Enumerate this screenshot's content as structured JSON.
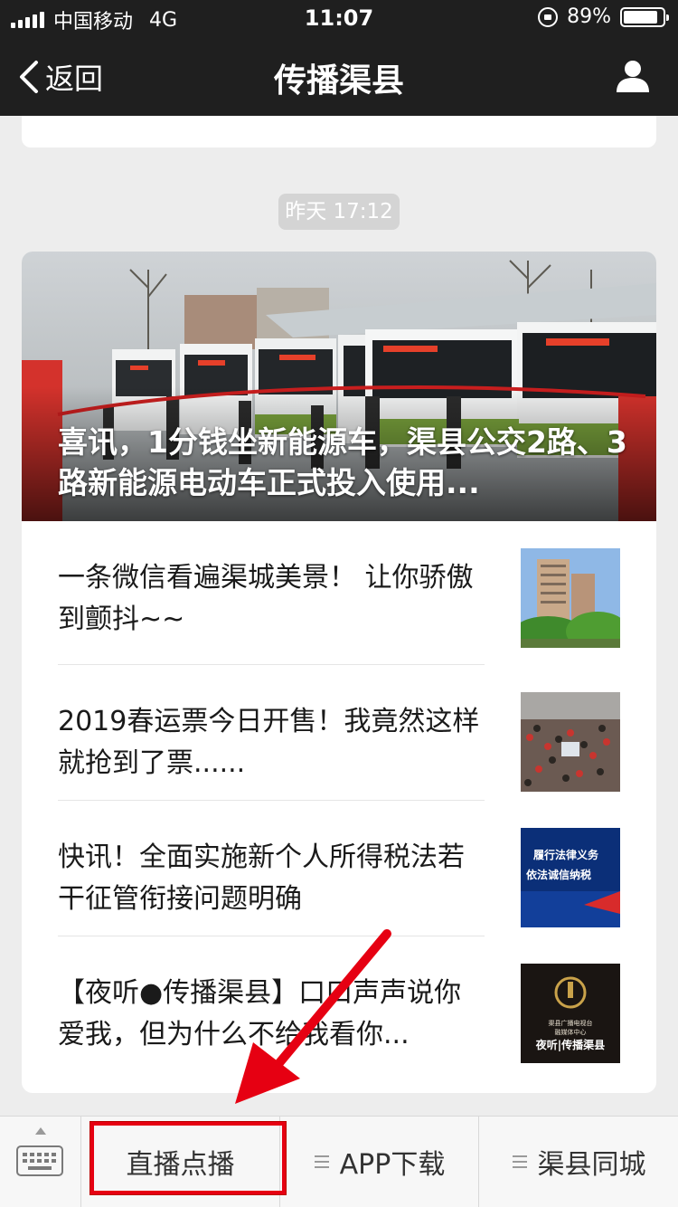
{
  "status_bar": {
    "carrier": "中国移动",
    "network": "4G",
    "time": "11:07",
    "battery_percent": "89%",
    "battery_level": 0.89
  },
  "nav": {
    "back_label": "返回",
    "title": "传播渠县"
  },
  "chat": {
    "timestamp": "昨天 17:12",
    "cover_article": {
      "title": "喜讯，1分钱坐新能源车，渠县公交2路、3路新能源电动车正式投入使用..."
    },
    "articles": [
      {
        "title": "一条微信看遍渠城美景！ 让你骄傲到颤抖~~",
        "thumb": "city-buildings"
      },
      {
        "title": "2019春运票今日开售！我竟然这样就抢到了票......",
        "thumb": "crowded-station"
      },
      {
        "title": "快讯！全面实施新个人所得税法若干征管衔接问题明确",
        "thumb": "tax-banner",
        "thumb_text": [
          "履行法律义务",
          "依法诚信纳税"
        ]
      },
      {
        "title": "【夜听●传播渠县】口口声声说你爱我，但为什么不给我看你...",
        "thumb": "night-listen-logo",
        "thumb_text": [
          "渠县广播电视台",
          "融媒体中心",
          "夜听|传播渠县"
        ]
      }
    ]
  },
  "menu": {
    "items": [
      {
        "label": "直播点播"
      },
      {
        "label": "APP下载"
      },
      {
        "label": "渠县同城"
      }
    ]
  },
  "colors": {
    "highlight": "#e60012",
    "topbar": "#1f1f1f",
    "background": "#ededed"
  }
}
